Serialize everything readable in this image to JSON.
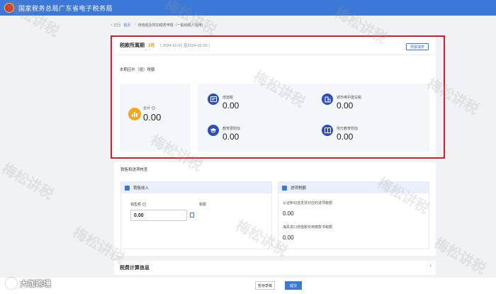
{
  "header": {
    "title": "国家税务总局广东省电子税务局"
  },
  "breadcrumb": {
    "back": "< 返回",
    "home": "首页",
    "current": "增值税及附加税费申报（一般纳税人适用）"
  },
  "period": {
    "label": "税款所属期",
    "month": "2月",
    "range": "（ 2024-02-01 至2024-02-29 ）",
    "switch_button": "预置填表"
  },
  "section_title": "本期应补（退）税额",
  "total": {
    "label": "合计",
    "value": "0.00"
  },
  "taxes": [
    {
      "name": "增值税",
      "value": "0.00",
      "icon": "vat-icon"
    },
    {
      "name": "城市维护建设税",
      "value": "0.00",
      "icon": "building-icon"
    },
    {
      "name": "教育费附加",
      "value": "0.00",
      "icon": "graduation-cap-icon"
    },
    {
      "name": "地方教育附加",
      "value": "0.00",
      "icon": "book-icon"
    }
  ],
  "sales": {
    "title": "销售和进项核查",
    "income": {
      "head": "销售收入",
      "amount_label": "销售额",
      "amount_value": "0.00",
      "tax_label": "税额"
    },
    "input": {
      "head": "进项税额",
      "label1": "认证和勾选发票对应的进项税额",
      "value1": "0.00",
      "label2": "海关进口增值税专用缴款书税额",
      "value2": "0.00"
    }
  },
  "calc": {
    "label": "税费计算信息",
    "chevron": "›"
  },
  "footer": {
    "draft_button": "暂存草稿",
    "submit_button": "提交"
  },
  "brand": {
    "text": "大咖跨境"
  },
  "watermark": {
    "text": "梅松讲税"
  },
  "colors": {
    "header": "#3c78d8",
    "highlight": "#d0202a",
    "accent_orange": "#f5a623",
    "icon_blue": "#2f4fb5"
  }
}
